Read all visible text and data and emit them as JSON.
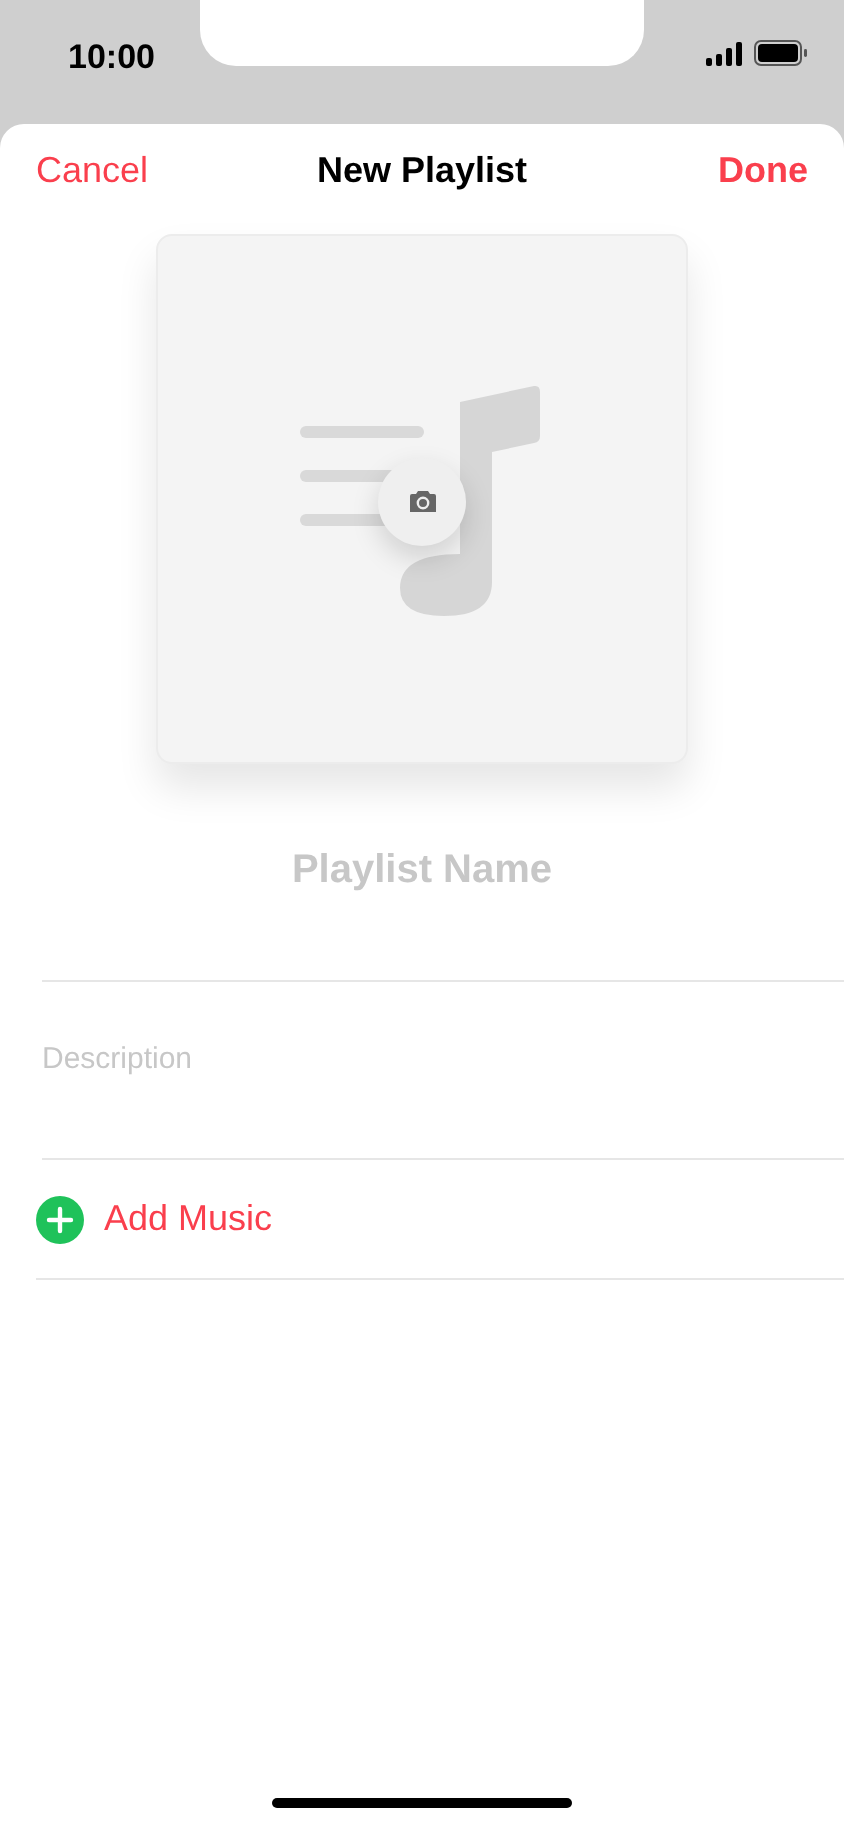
{
  "status_bar": {
    "time": "10:00"
  },
  "nav": {
    "cancel": "Cancel",
    "title": "New Playlist",
    "done": "Done"
  },
  "artwork": {
    "kind": "placeholder"
  },
  "name_field": {
    "placeholder": "Playlist Name"
  },
  "description_field": {
    "placeholder": "Description"
  },
  "add_music": {
    "label": "Add Music"
  }
}
